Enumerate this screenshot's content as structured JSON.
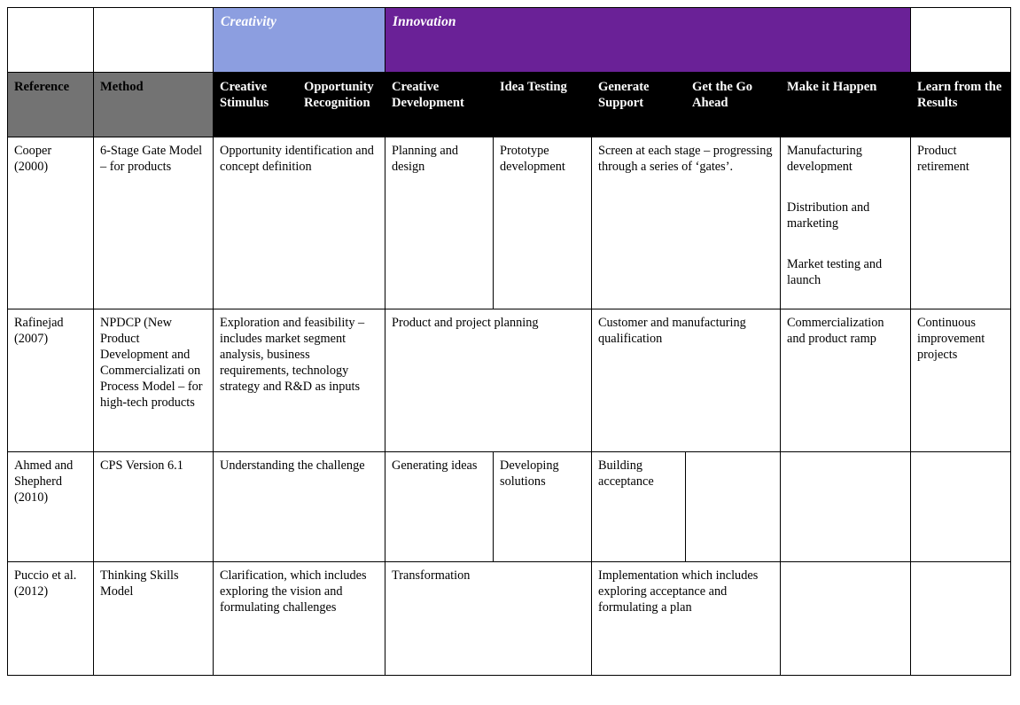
{
  "colors": {
    "creativity_band": "#8c9ee0",
    "innovation_band": "#6a2197",
    "header_gray": "#737373",
    "header_black": "#000000",
    "text": "#000000",
    "header_text": "#ffffff"
  },
  "bands": {
    "creativity": "Creativity",
    "innovation": "Innovation"
  },
  "headers": {
    "reference": "Reference",
    "method": "Method",
    "creative_stimulus": "Creative Stimulus",
    "opportunity_recognition": "Opportunity Recognition",
    "creative_development": "Creative Development",
    "idea_testing": "Idea Testing",
    "generate_support": "Generate Support",
    "get_the_go_ahead": "Get the Go Ahead",
    "make_it_happen": "Make it Happen",
    "learn_from_the_results": "Learn from the Results"
  },
  "rows": [
    {
      "reference": "Cooper (2000)",
      "method": "6-Stage Gate Model – for products",
      "creative_stimulus": "Opportunity identification and concept definition",
      "creative_development": "Planning and design",
      "idea_testing": "Prototype development",
      "generate_support": "Screen at each stage – progressing through a series of ‘gates’.",
      "make_it_happen_1": "Manufacturing development",
      "make_it_happen_2": "Distribution and marketing",
      "make_it_happen_3": "Market testing and launch",
      "learn_from_the_results": "Product retirement"
    },
    {
      "reference": "Rafinejad (2007)",
      "method": "NPDCP (New Product Development and Commercializati on Process Model – for high-tech products",
      "creative_stimulus": "Exploration and feasibility – includes market segment analysis, business requirements, technology strategy and R&D as inputs",
      "creative_development": "Product and project planning",
      "generate_support": "Customer and manufacturing qualification",
      "make_it_happen": "Commercialization and  product ramp",
      "learn_from_the_results": "Continuous improvement projects"
    },
    {
      "reference": "Ahmed and Shepherd (2010)",
      "method": "CPS Version 6.1",
      "creative_stimulus": "Understanding the challenge",
      "creative_development": "Generating ideas",
      "idea_testing": "Developing solutions",
      "generate_support": "Building acceptance",
      "get_the_go_ahead": "",
      "make_it_happen": "",
      "learn_from_the_results": ""
    },
    {
      "reference": "Puccio et al. (2012)",
      "method": "Thinking Skills Model",
      "creative_stimulus": "Clarification, which includes exploring the vision and formulating challenges",
      "creative_development": "Transformation",
      "generate_support": "Implementation which includes exploring acceptance and formulating a plan",
      "make_it_happen": "",
      "learn_from_the_results": ""
    }
  ]
}
